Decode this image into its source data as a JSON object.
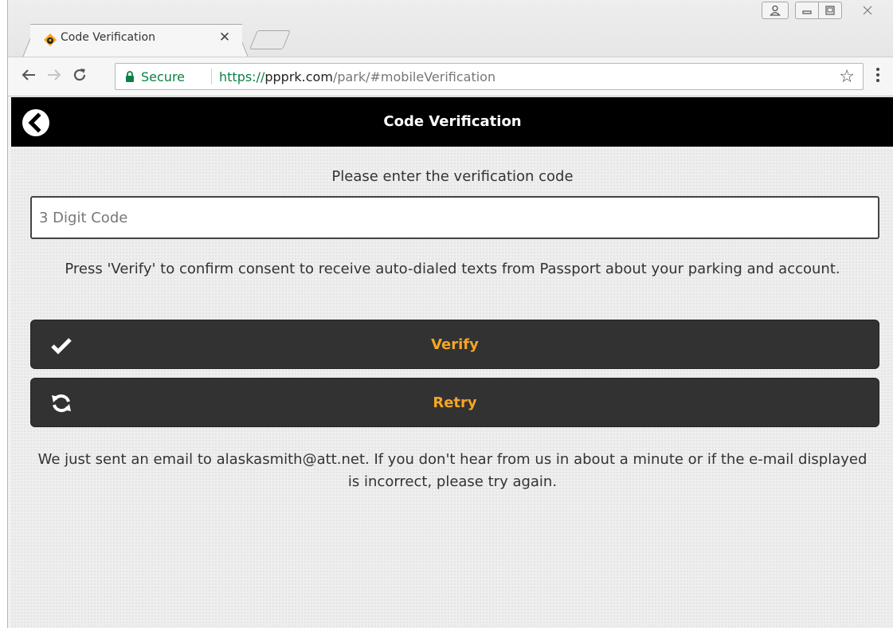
{
  "browser": {
    "tab_title": "Code Verification",
    "secure_label": "Secure",
    "url_scheme": "https://",
    "url_host": "ppprk.com",
    "url_path": "/park/#mobileVerification"
  },
  "header": {
    "title": "Code Verification"
  },
  "form": {
    "prompt": "Please enter the verification code",
    "code_placeholder": "3 Digit Code",
    "code_value": "",
    "consent_text": "Press 'Verify' to confirm consent to receive auto-dialed texts from Passport about your parking and account.",
    "verify_label": "Verify",
    "retry_label": "Retry",
    "notice_text": "We just sent an email to alaskasmith@att.net. If you don't hear from us in about a minute or if the e-mail displayed is incorrect, please try again."
  },
  "colors": {
    "accent": "#f5a623",
    "button_bg": "#323232",
    "header_bg": "#000000",
    "secure_green": "#0b8043"
  },
  "icons": {
    "back": "chevron-left-circle-icon",
    "verify": "checkmark-icon",
    "retry": "refresh-icon"
  }
}
